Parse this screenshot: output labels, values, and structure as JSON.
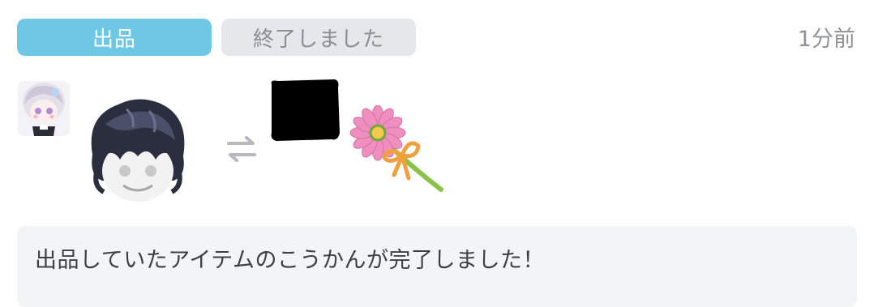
{
  "tabs": {
    "listed_label": "出品",
    "ended_label": "終了しました"
  },
  "timestamp": "1分前",
  "message": "出品していたアイテムのこうかんが完了しました！",
  "colors": {
    "accent": "#6fc7e6",
    "inactive_bg": "#e6e7ea",
    "muted_text": "#8f9297",
    "message_bg": "#f3f4f5"
  },
  "icons": {
    "swap": "swap-arrows-icon",
    "user_avatar": "user-avatar",
    "offered_item": "dark-hair-item",
    "received_item": "pink-flower-item"
  }
}
